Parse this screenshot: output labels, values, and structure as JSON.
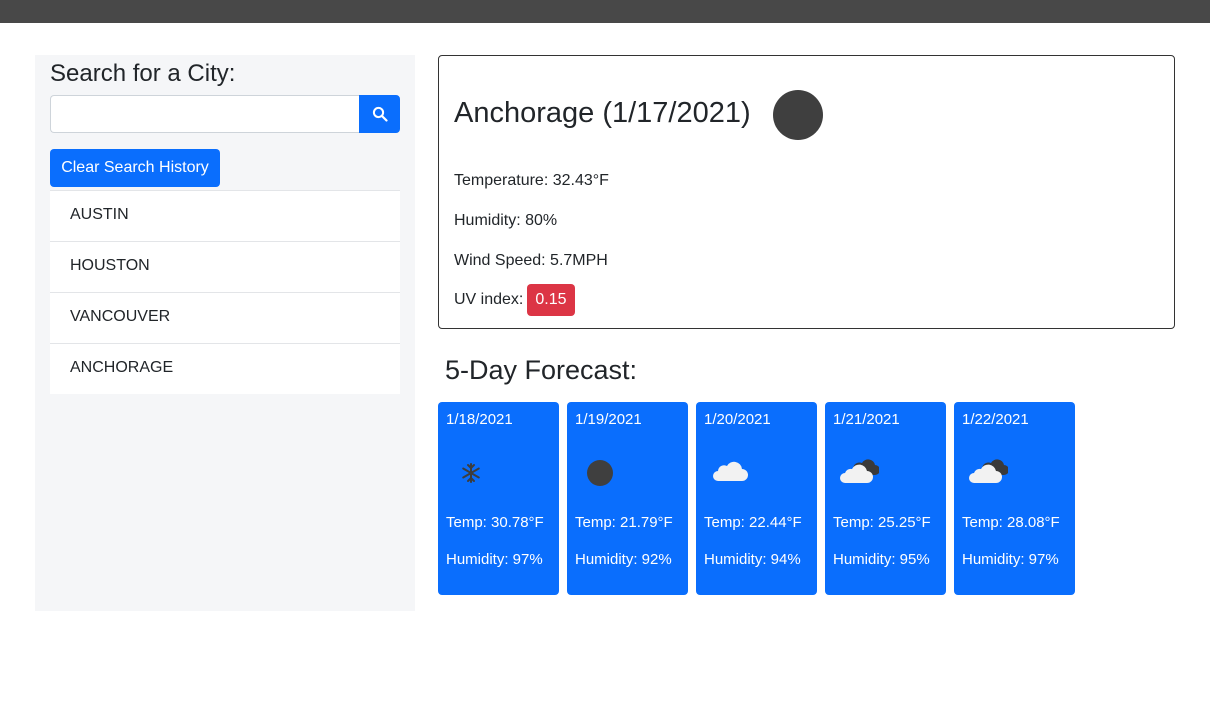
{
  "sidebar": {
    "title": "Search for a City:",
    "search": {
      "value": "",
      "placeholder": ""
    },
    "search_button_icon": "search-icon",
    "clear_button_label": "Clear Search History",
    "history": [
      "AUSTIN",
      "HOUSTON",
      "VANCOUVER",
      "ANCHORAGE"
    ]
  },
  "current": {
    "city_title": "Anchorage (1/17/2021)",
    "icon": "moon-dark-icon",
    "temperature": "Temperature: 32.43°F",
    "humidity": "Humidity: 80%",
    "wind": "Wind Speed: 5.7MPH",
    "uv_label": "UV index:",
    "uv_value": "0.15"
  },
  "forecast": {
    "title": "5-Day Forecast:",
    "days": [
      {
        "date": "1/18/2021",
        "icon": "snow-icon",
        "temp": "Temp: 30.78°F",
        "humidity": "Humidity: 97%"
      },
      {
        "date": "1/19/2021",
        "icon": "dark-circle-icon",
        "temp": "Temp: 21.79°F",
        "humidity": "Humidity: 92%"
      },
      {
        "date": "1/20/2021",
        "icon": "cloud-icon",
        "temp": "Temp: 22.44°F",
        "humidity": "Humidity: 94%"
      },
      {
        "date": "1/21/2021",
        "icon": "cloud-dark-icon",
        "temp": "Temp: 25.25°F",
        "humidity": "Humidity: 95%"
      },
      {
        "date": "1/22/2021",
        "icon": "cloud-dark-icon",
        "temp": "Temp: 28.08°F",
        "humidity": "Humidity: 97%"
      }
    ]
  },
  "colors": {
    "topbar": "#484848",
    "primary": "#0a6efd",
    "uv_badge": "#dc3545",
    "sidebar_bg": "#f5f6f8"
  }
}
